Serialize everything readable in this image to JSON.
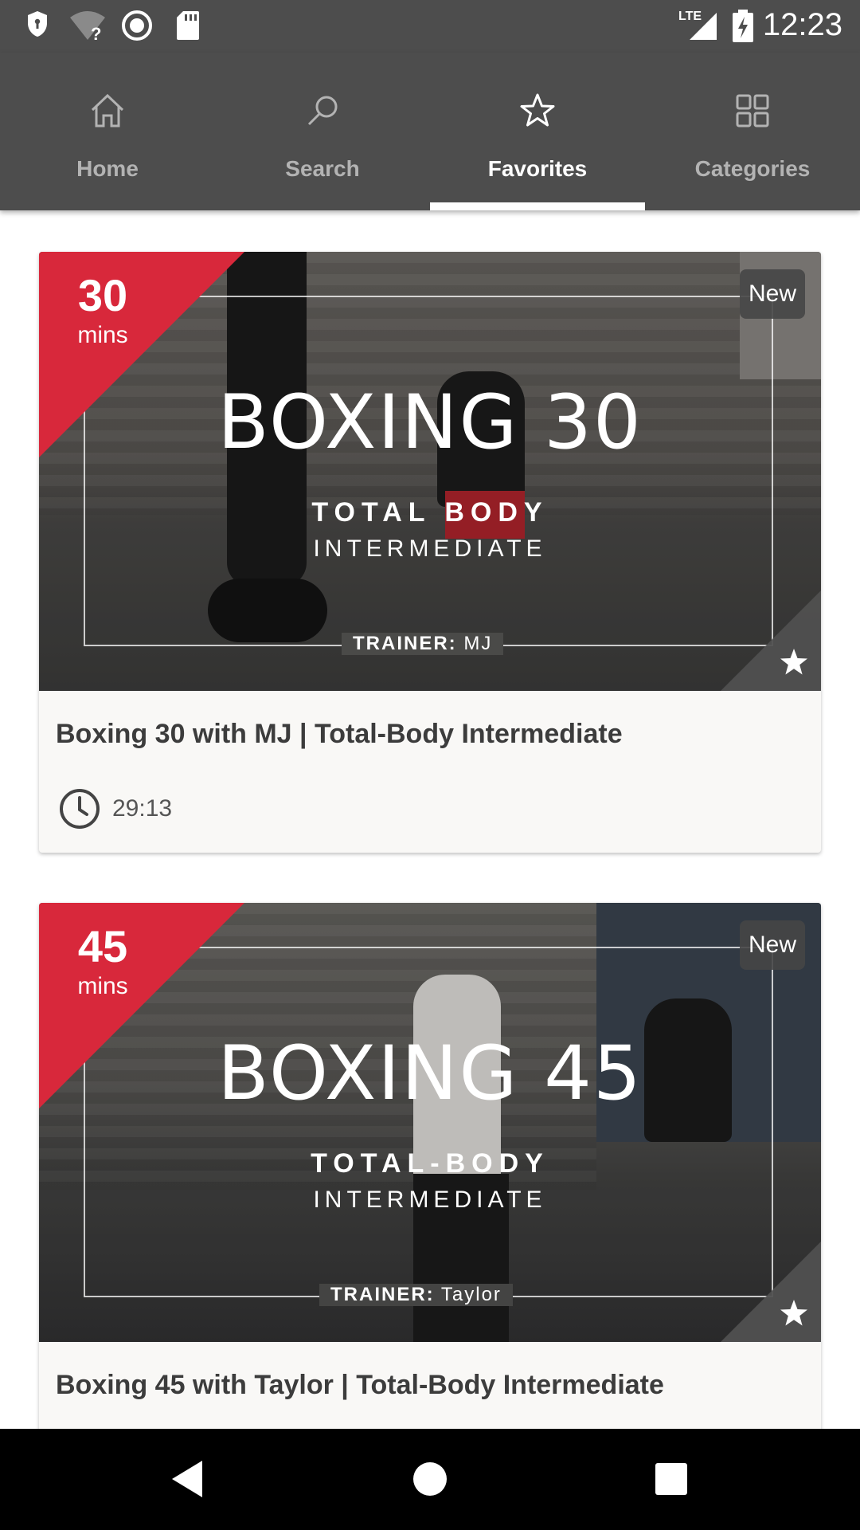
{
  "status_bar": {
    "time": "12:23",
    "network": "LTE",
    "icons": [
      "shield-icon",
      "wifi-unknown-icon",
      "sync-circle-icon",
      "sd-card-icon",
      "signal-icon",
      "battery-charging-icon"
    ]
  },
  "tabs": [
    {
      "label": "Home",
      "icon": "home-icon",
      "active": false
    },
    {
      "label": "Search",
      "icon": "search-icon",
      "active": false
    },
    {
      "label": "Favorites",
      "icon": "star-outline-icon",
      "active": true
    },
    {
      "label": "Categories",
      "icon": "grid-icon",
      "active": false
    }
  ],
  "cards": [
    {
      "title": "Boxing 30 with MJ | Total-Body Intermediate",
      "duration": "29:13",
      "badge": "New",
      "thumbnail": {
        "mins_number": "30",
        "mins_label": "mins",
        "headline": "BOXING 30",
        "subline1": "TOTAL BODY",
        "subline2": "INTERMEDIATE",
        "trainer_label": "TRAINER:",
        "trainer_name": "MJ"
      },
      "favorited": true
    },
    {
      "title": "Boxing 45 with Taylor | Total-Body Intermediate",
      "duration": "",
      "badge": "New",
      "thumbnail": {
        "mins_number": "45",
        "mins_label": "mins",
        "headline": "BOXING 45",
        "subline1": "TOTAL-BODY",
        "subline2": "INTERMEDIATE",
        "trainer_label": "TRAINER:",
        "trainer_name": "Taylor"
      },
      "favorited": true
    }
  ],
  "colors": {
    "app_bar": "#4d4d4d",
    "accent_red": "#d8283b",
    "card_bg": "#f9f8f6",
    "text_dark": "#3c3c3c"
  },
  "nav_bar": {
    "buttons": [
      "back-icon",
      "home-circle-icon",
      "recents-square-icon"
    ]
  }
}
